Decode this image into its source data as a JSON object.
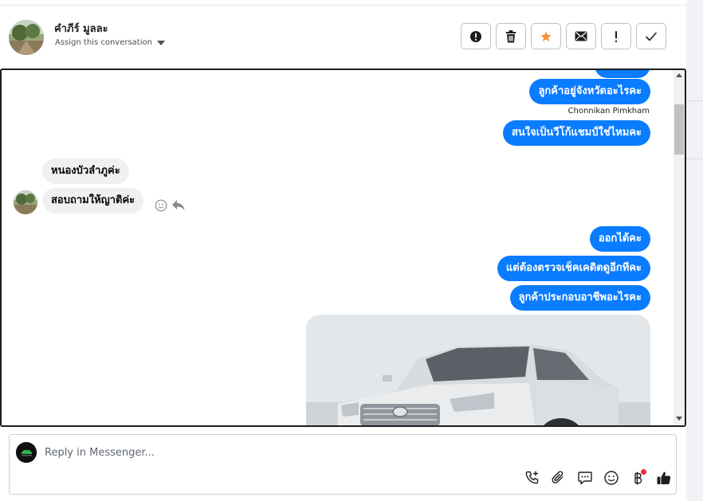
{
  "header": {
    "contact_name": "คำภีร์ มูลละ",
    "assign_label": "Assign this conversation",
    "actions": [
      {
        "name": "mark-spam",
        "icon": "alert-circle-icon"
      },
      {
        "name": "delete",
        "icon": "trash-icon"
      },
      {
        "name": "star",
        "icon": "star-icon",
        "color": "#f7923b"
      },
      {
        "name": "mark-unread",
        "icon": "envelope-icon"
      },
      {
        "name": "follow-up",
        "icon": "exclamation-icon"
      },
      {
        "name": "mark-done",
        "icon": "check-icon"
      }
    ]
  },
  "messages": {
    "out_1": "ลูกค้าอยู่จังหวัดอะไรคะ",
    "sender_1": "Chonnikan Pimkham",
    "out_2": "สนใจเป็นวีโก้แชมป์ใช่ไหมคะ",
    "in_1": "หนองบัวลำภูค่ะ",
    "in_2": "สอบถามให้ญาติค่ะ",
    "out_3": "ออกได้คะ",
    "out_4": "แต่ต้องตรวจเช็คเคดิตดูอีกทีคะ",
    "out_5": "ลูกค้าประกอบอาชีพอะไรคะ",
    "photo": "pickup-truck-photo"
  },
  "composer": {
    "placeholder": "Reply in Messenger...",
    "tools": [
      "phone-add-icon",
      "paperclip-icon",
      "saved-reply-icon",
      "emoji-icon",
      "baht-icon",
      "thumbs-up-icon"
    ]
  },
  "colors": {
    "outgoing_bubble": "#0a7cff",
    "incoming_bubble": "#f0f0f0",
    "star": "#f7923b",
    "notify_dot": "#f02849"
  }
}
